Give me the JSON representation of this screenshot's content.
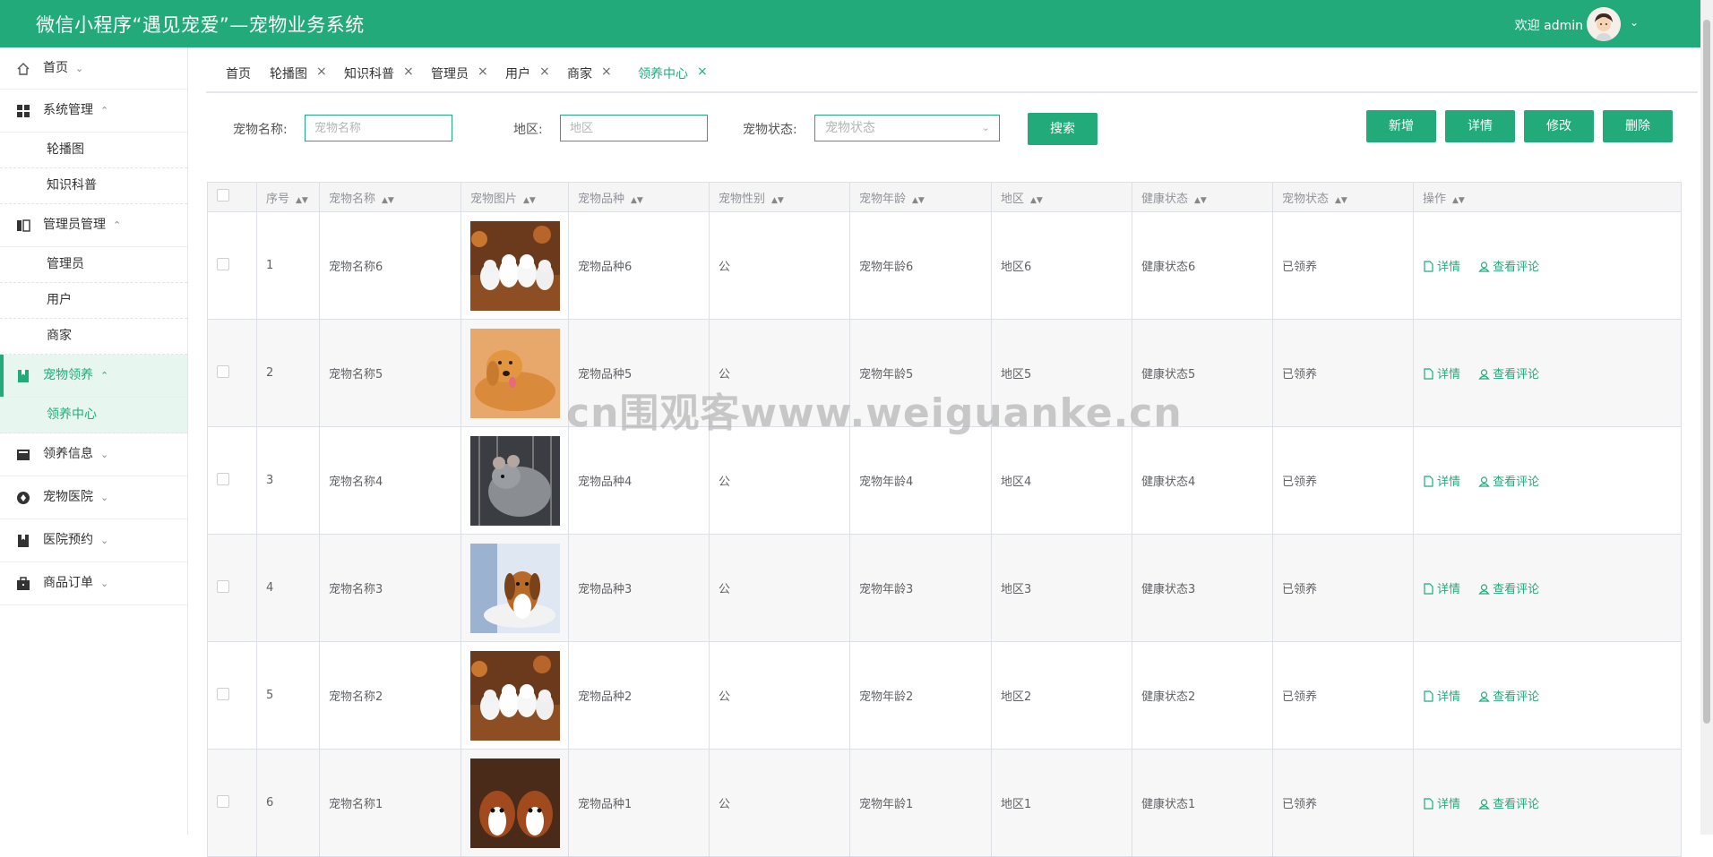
{
  "header": {
    "title": "微信小程序“遇见宠爱”—宠物业务系统",
    "welcome": "欢迎 admin",
    "brand_color": "#23aa7a"
  },
  "sidebar": {
    "home": "首页",
    "system": {
      "label": "系统管理",
      "children": [
        "轮播图",
        "知识科普"
      ]
    },
    "admin": {
      "label": "管理员管理",
      "children": [
        "管理员",
        "用户",
        "商家"
      ]
    },
    "adopt": {
      "label": "宠物领养",
      "children": [
        "领养中心"
      ]
    },
    "adopt_info": "领养信息",
    "hospital": "宠物医院",
    "booking": "医院预约",
    "orders": "商品订单"
  },
  "tabs": [
    "首页",
    "轮播图",
    "知识科普",
    "管理员",
    "用户",
    "商家",
    "领养中心"
  ],
  "search": {
    "name_label": "宠物名称:",
    "name_placeholder": "宠物名称",
    "region_label": "地区:",
    "region_placeholder": "地区",
    "status_label": "宠物状态:",
    "status_placeholder": "宠物状态",
    "search_btn": "搜索"
  },
  "actions": {
    "add": "新增",
    "detail": "详情",
    "edit": "修改",
    "delete": "删除"
  },
  "table": {
    "headers": [
      "序号",
      "宠物名称",
      "宠物图片",
      "宠物品种",
      "宠物性别",
      "宠物年龄",
      "地区",
      "健康状态",
      "宠物状态",
      "操作"
    ],
    "row_actions": {
      "detail": "详情",
      "comments": "查看评论"
    },
    "rows": [
      {
        "no": "1",
        "name": "宠物名称6",
        "breed": "宠物品种6",
        "gender": "公",
        "age": "宠物年龄6",
        "region": "地区6",
        "health": "健康状态6",
        "status": "已领养"
      },
      {
        "no": "2",
        "name": "宠物名称5",
        "breed": "宠物品种5",
        "gender": "公",
        "age": "宠物年龄5",
        "region": "地区5",
        "health": "健康状态5",
        "status": "已领养"
      },
      {
        "no": "3",
        "name": "宠物名称4",
        "breed": "宠物品种4",
        "gender": "公",
        "age": "宠物年龄4",
        "region": "地区4",
        "health": "健康状态4",
        "status": "已领养"
      },
      {
        "no": "4",
        "name": "宠物名称3",
        "breed": "宠物品种3",
        "gender": "公",
        "age": "宠物年龄3",
        "region": "地区3",
        "health": "健康状态3",
        "status": "已领养"
      },
      {
        "no": "5",
        "name": "宠物名称2",
        "breed": "宠物品种2",
        "gender": "公",
        "age": "宠物年龄2",
        "region": "地区2",
        "health": "健康状态2",
        "status": "已领养"
      },
      {
        "no": "6",
        "name": "宠物名称1",
        "breed": "宠物品种1",
        "gender": "公",
        "age": "宠物年龄1",
        "region": "地区1",
        "health": "健康状态1",
        "status": "已领养"
      }
    ]
  },
  "watermark": "cn围观客www.weiguanke.cn"
}
